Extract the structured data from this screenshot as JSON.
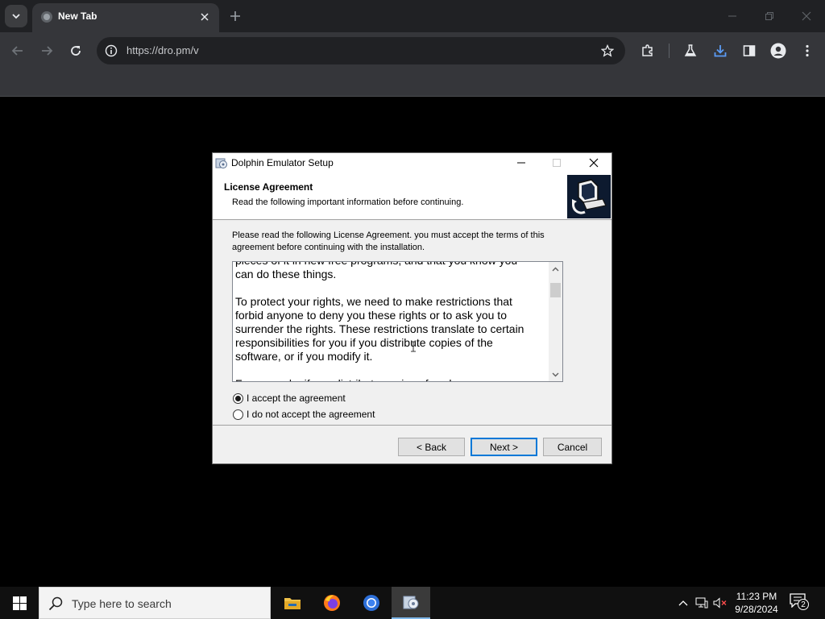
{
  "browser": {
    "tab_title": "New Tab",
    "url": "https://dro.pm/v",
    "icons": [
      "tab-search-icon",
      "favicon-icon",
      "close-tab-icon",
      "new-tab-icon",
      "minimize-icon",
      "restore-icon",
      "close-window-icon",
      "back-icon",
      "forward-icon",
      "reload-icon",
      "site-info-icon",
      "bookmark-star-icon",
      "extensions-icon",
      "labs-icon",
      "downloads-icon",
      "side-panel-icon",
      "profile-icon",
      "menu-icon"
    ]
  },
  "dialog": {
    "title": "Dolphin Emulator Setup",
    "header_title": "License Agreement",
    "header_subtitle": "Read the following important information before continuing.",
    "intro": "Please read the following License Agreement. you must accept the terms of this agreement before continuing with the installation.",
    "license_text": "pieces of it in new free programs, and that you know you\ncan do these things.\n\nTo protect your rights, we need to make restrictions that\nforbid anyone to deny you these rights or to ask you to\nsurrender the rights. These restrictions translate to certain\nresponsibilities for you if you distribute copies of the\nsoftware, or if you modify it.\n\nFor example, if you distribute copies of such a program,",
    "radio_accept": "I accept the agreement",
    "radio_decline": "I do not accept the agreement",
    "selected": "accept",
    "back_label": "< Back",
    "next_label": "Next >",
    "cancel_label": "Cancel"
  },
  "taskbar": {
    "search_placeholder": "Type here to search",
    "time": "11:23 PM",
    "date": "9/28/2024",
    "notification_count": "2",
    "apps": [
      "file-explorer-icon",
      "firefox-icon",
      "chrome-icon",
      "setup-app-icon"
    ]
  },
  "colors": {
    "browser_frame": "#202124",
    "browser_toolbar": "#35363a",
    "dialog_bg": "#f0f0f0",
    "accent_blue": "#0078d7",
    "taskbar_bg": "#101010"
  }
}
